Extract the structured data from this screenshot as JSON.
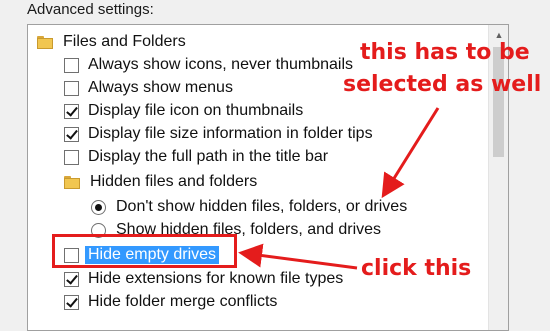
{
  "section": {
    "label": "Advanced settings:"
  },
  "tree": {
    "folder_root": {
      "label": "Files and Folders",
      "icon": "folder-icon"
    },
    "items": [
      {
        "label": "Always show icons, never thumbnails",
        "checked": false
      },
      {
        "label": "Always show menus",
        "checked": false
      },
      {
        "label": "Display file icon on thumbnails",
        "checked": true
      },
      {
        "label": "Display file size information in folder tips",
        "checked": true
      },
      {
        "label": "Display the full path in the title bar",
        "checked": false
      }
    ],
    "hidden_folder": {
      "label": "Hidden files and folders",
      "icon": "folder-icon"
    },
    "radios": [
      {
        "label": "Don't show hidden files, folders, or drives",
        "selected": true
      },
      {
        "label": "Show hidden files, folders, and drives",
        "selected": false
      }
    ],
    "after_items": [
      {
        "label": "Hide empty drives",
        "checked": false,
        "highlighted": true
      },
      {
        "label": "Hide extensions for known file types",
        "checked": true
      },
      {
        "label": "Hide folder merge conflicts",
        "checked": true
      }
    ]
  },
  "annotations": {
    "top_line1": "this has to be",
    "top_line2": "selected as well",
    "bottom": "click this",
    "color": "#e41c1c"
  }
}
